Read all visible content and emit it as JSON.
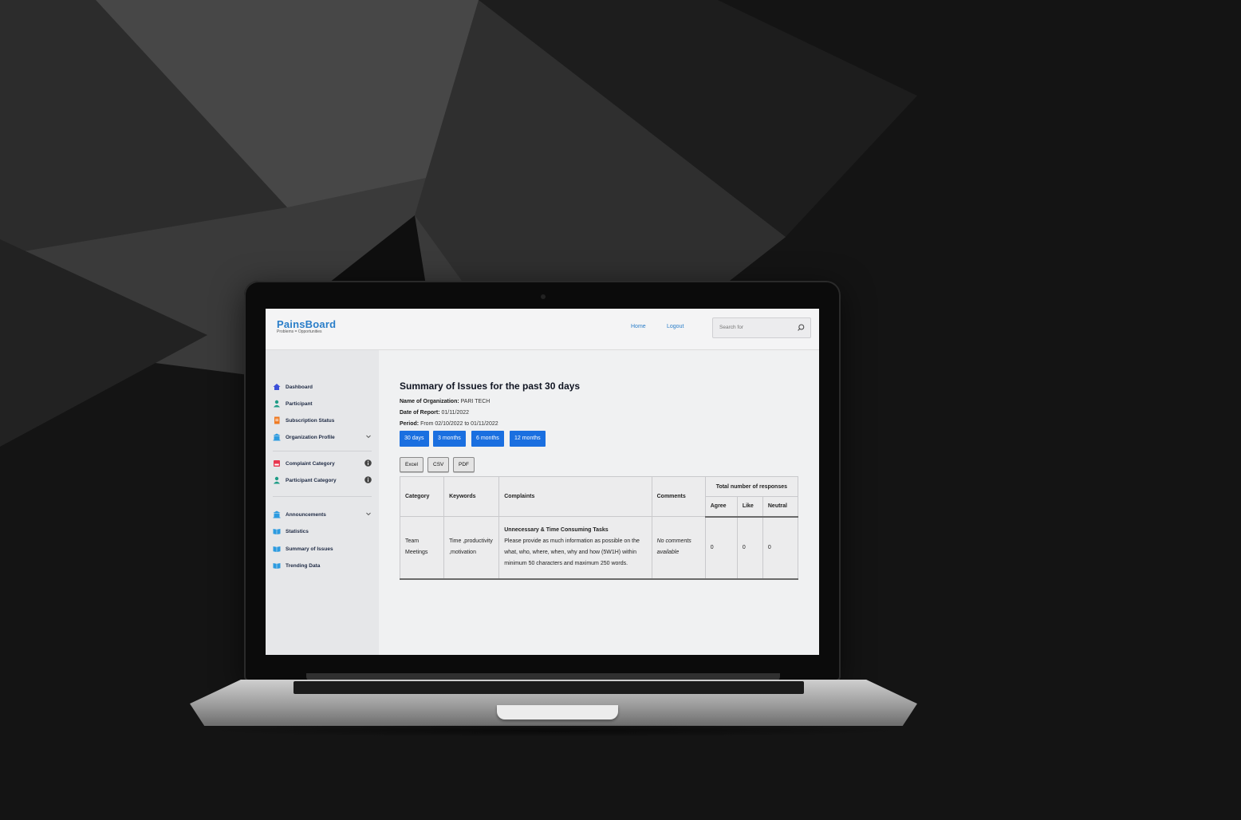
{
  "app": {
    "brand_name": "PainsBoard",
    "brand_tagline": "Problems = Opportunities",
    "accent_color": "#2a7ec9",
    "button_color": "#1a6fe0"
  },
  "header": {
    "nav": [
      {
        "label": "Home"
      },
      {
        "label": "Logout"
      }
    ],
    "search_placeholder": "Search for"
  },
  "sidebar": {
    "items": [
      {
        "label": "Dashboard",
        "icon": "home-icon"
      },
      {
        "label": "Participant",
        "icon": "user-icon"
      },
      {
        "label": "Subscription Status",
        "icon": "document-icon"
      },
      {
        "label": "Organization Profile",
        "icon": "building-icon",
        "trail": "chevron-down-icon"
      },
      {
        "label": "Complaint Category",
        "icon": "inbox-icon",
        "trail": "info-icon"
      },
      {
        "label": "Participant Category",
        "icon": "user-icon",
        "trail": "info-icon"
      },
      {
        "label": "Announcements",
        "icon": "building-icon",
        "trail": "chevron-down-icon"
      },
      {
        "label": "Statistics",
        "icon": "book-icon"
      },
      {
        "label": "Summary of Issues",
        "icon": "book-icon"
      },
      {
        "label": "Trending Data",
        "icon": "book-icon"
      }
    ]
  },
  "report": {
    "title": "Summary of Issues for the past 30 days",
    "org_label": "Name of Organization:",
    "org_value": "PARI TECH",
    "date_label": "Date of Report:",
    "date_value": "01/11/2022",
    "period_label": "Period:",
    "period_value": "From 02/10/2022 to 01/11/2022",
    "period_buttons": [
      "30 days",
      "3 months",
      "6 months",
      "12 months"
    ],
    "export_buttons": [
      "Excel",
      "CSV",
      "PDF"
    ]
  },
  "table": {
    "headers": {
      "category": "Category",
      "keywords": "Keywords",
      "complaints": "Complaints",
      "comments": "Comments",
      "responses_group": "Total number of responses",
      "agree": "Agree",
      "like": "Like",
      "neutral": "Neutral"
    },
    "rows": [
      {
        "category": "Team Meetings",
        "keywords": "Time ,productivity ,motivation",
        "complaint_title": "Unnecessary & Time Consuming Tasks",
        "complaint_body": "Please provide as much information as possible on the what, who, where, when, why and how (5W1H) within minimum 50 characters and maximum 250 words.",
        "comments": "No comments available",
        "agree": "0",
        "like": "0",
        "neutral": "0"
      }
    ]
  }
}
